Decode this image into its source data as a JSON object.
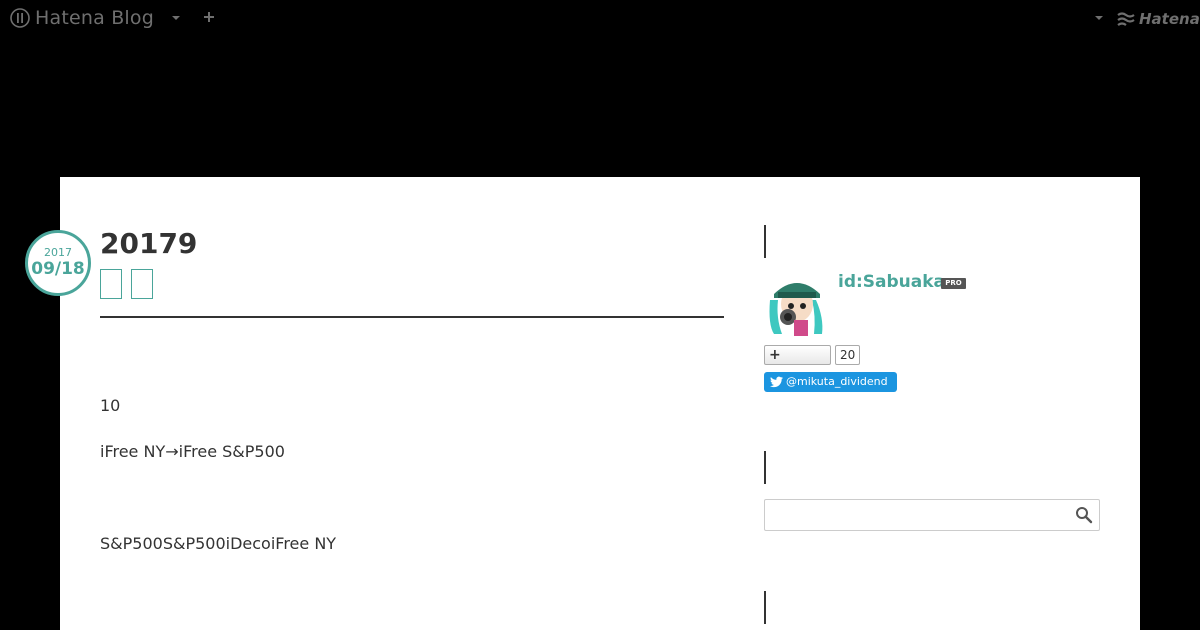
{
  "header": {
    "logo_text": "Hatena Blog",
    "brand_text": "Hatena"
  },
  "entry": {
    "date_year": "2017",
    "date_day": "09/18",
    "title": "20179",
    "paragraphs": [
      "10",
      "iFree NY→iFree S&P500",
      "S&P500S&P500iDecoiFree NY"
    ]
  },
  "sidebar": {
    "profile_id": "id:Sabuaka",
    "pro_badge": "PRO",
    "subscribe_icon": "plus-icon",
    "subscriber_count": "20",
    "twitter_handle": "@mikuta_dividend",
    "search_placeholder": ""
  },
  "colors": {
    "accent": "#4aa59a",
    "twitter": "#1b95e0",
    "background": "#000000"
  }
}
